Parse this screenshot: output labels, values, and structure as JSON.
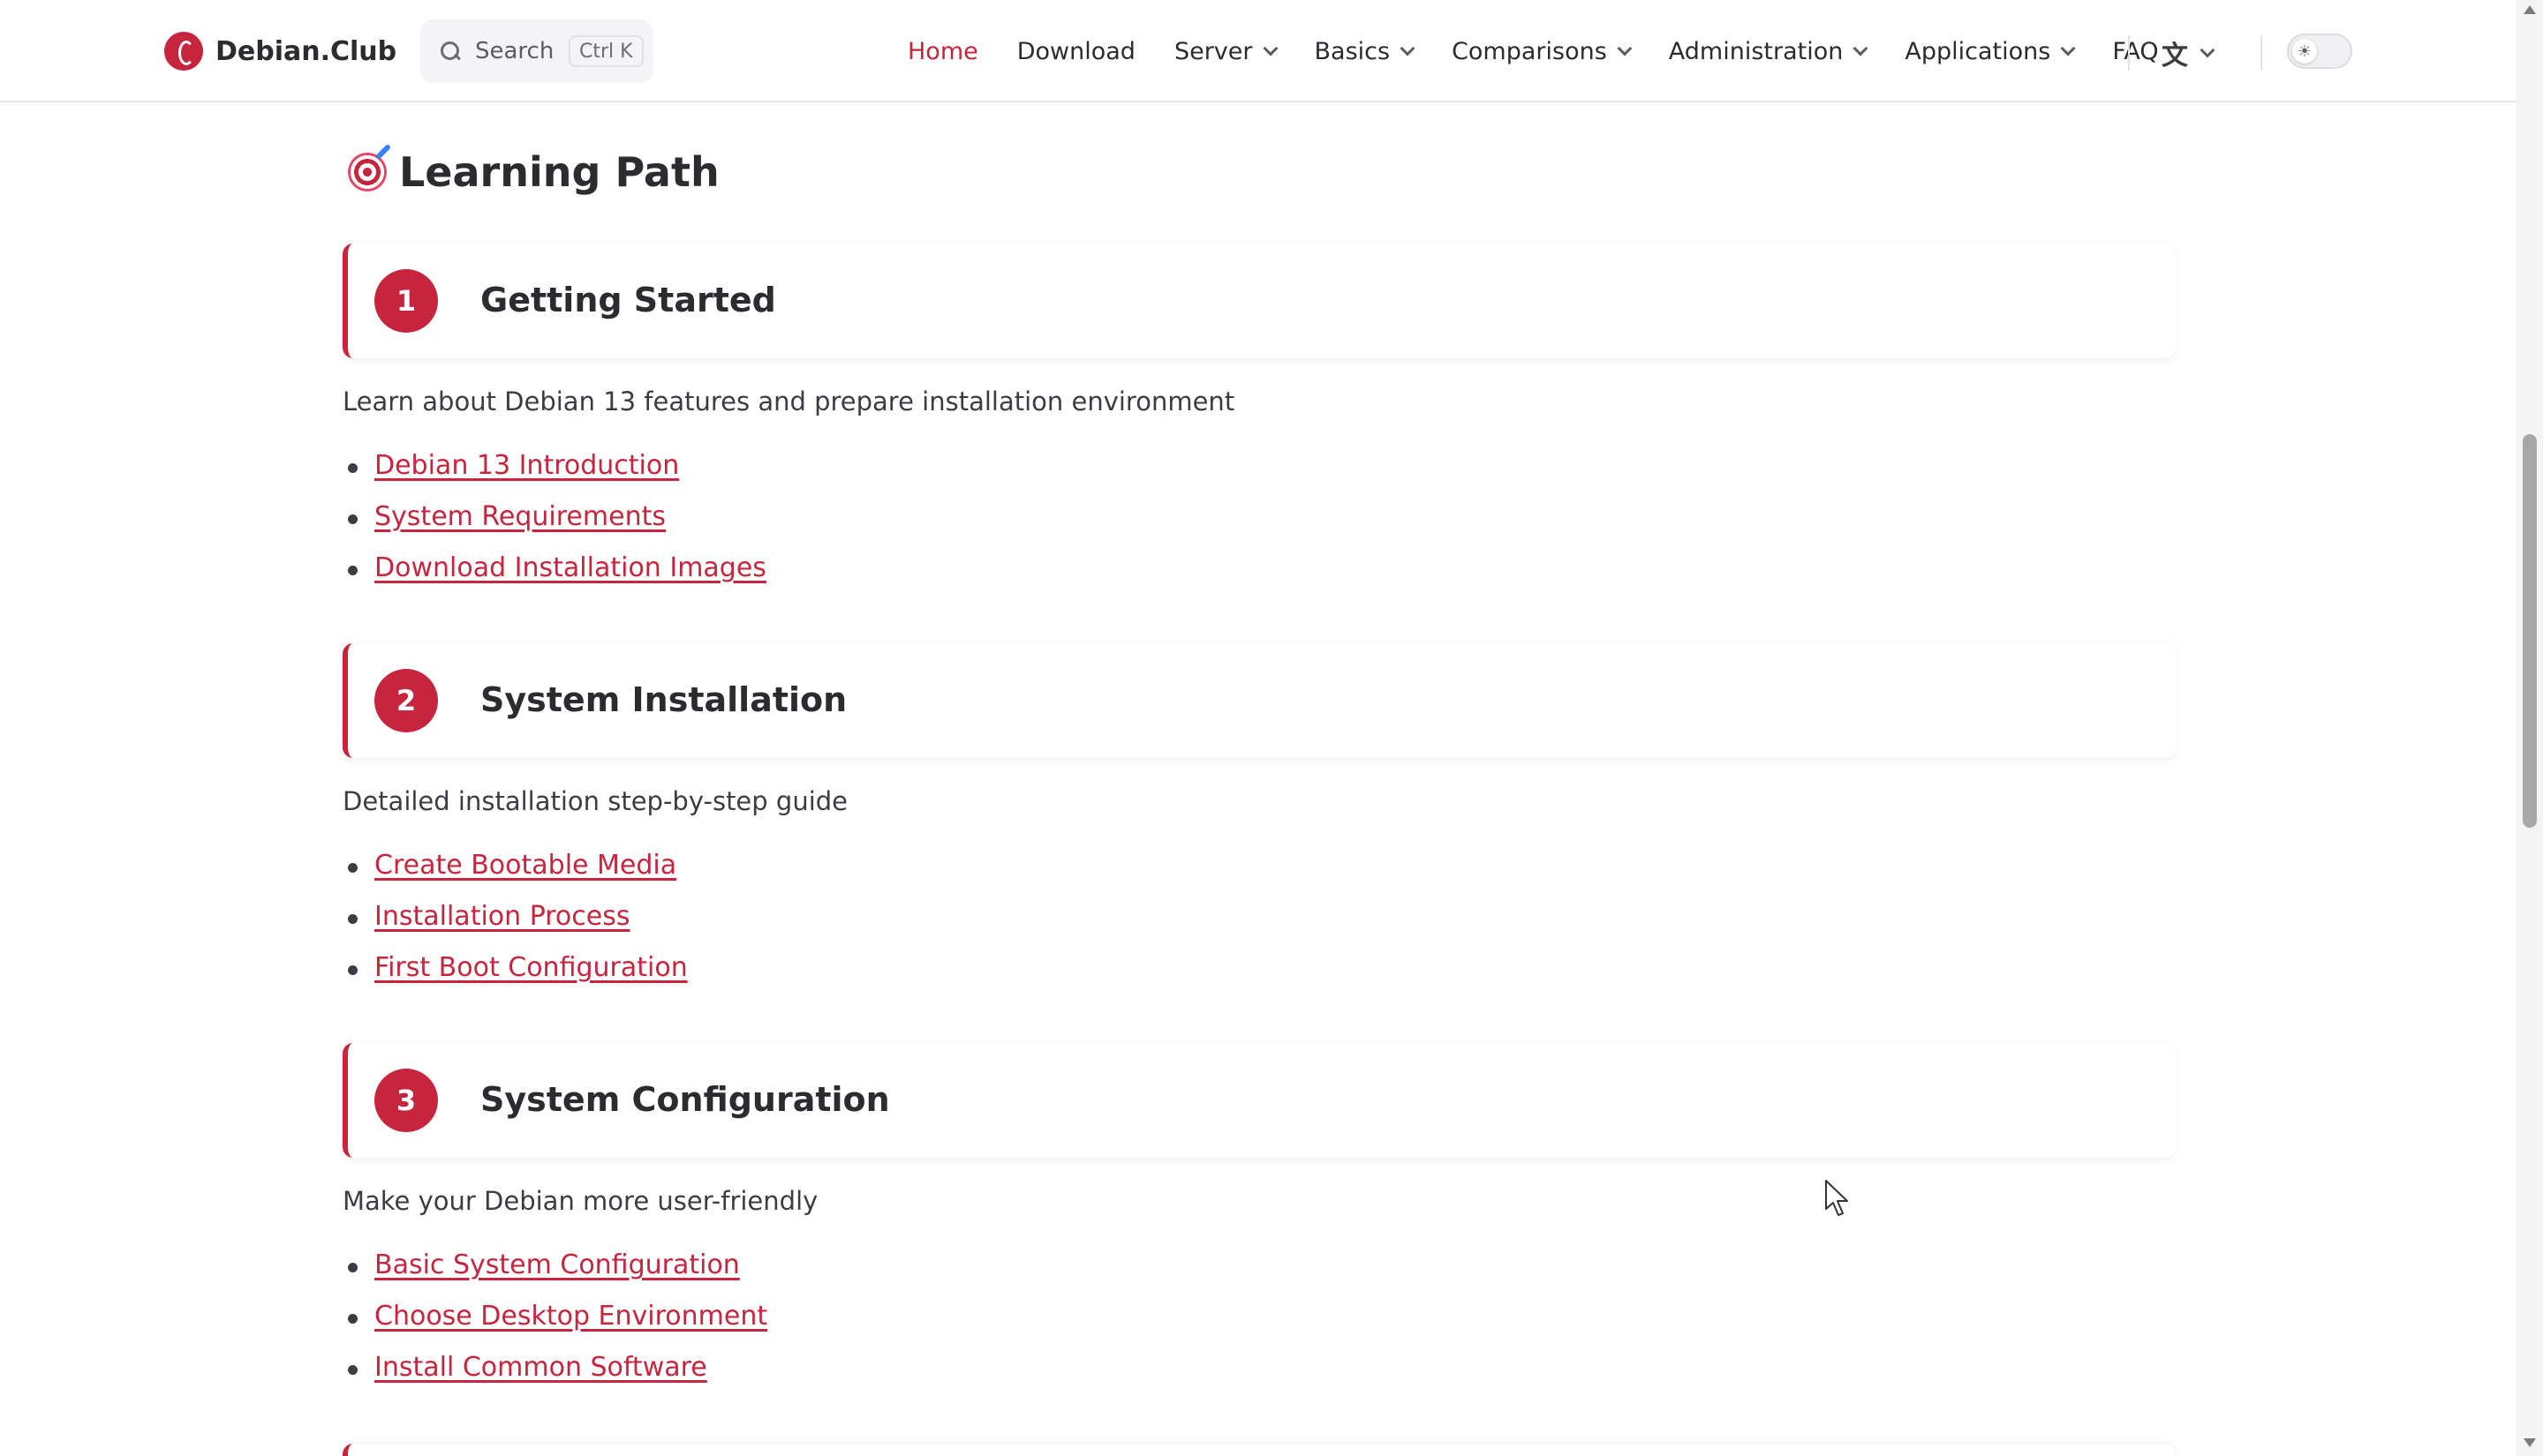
{
  "brand": {
    "name": "Debian.Club"
  },
  "search": {
    "label": "Search",
    "shortcut": "Ctrl K"
  },
  "nav": {
    "items": [
      {
        "label": "Home",
        "active": true,
        "dropdown": false
      },
      {
        "label": "Download",
        "dropdown": false
      },
      {
        "label": "Server",
        "dropdown": true
      },
      {
        "label": "Basics",
        "dropdown": true
      },
      {
        "label": "Comparisons",
        "dropdown": true
      },
      {
        "label": "Administration",
        "dropdown": true
      },
      {
        "label": "Applications",
        "dropdown": true
      },
      {
        "label": "FAQ",
        "dropdown": false
      }
    ],
    "language_icon": "translate-icon",
    "theme_icon": "sun-icon"
  },
  "colors": {
    "accent": "#c7253e",
    "text": "#3c3c43",
    "heading": "#2c2c30"
  },
  "main": {
    "section_title": "Learning Path",
    "section_icon": "target-icon",
    "steps": [
      {
        "number": "1",
        "title": "Getting Started",
        "description": "Learn about Debian 13 features and prepare installation environment",
        "links": [
          "Debian 13 Introduction",
          "System Requirements",
          "Download Installation Images"
        ]
      },
      {
        "number": "2",
        "title": "System Installation",
        "description": "Detailed installation step-by-step guide",
        "links": [
          "Create Bootable Media",
          "Installation Process",
          "First Boot Configuration"
        ]
      },
      {
        "number": "3",
        "title": "System Configuration",
        "description": "Make your Debian more user-friendly",
        "links": [
          "Basic System Configuration",
          "Choose Desktop Environment",
          "Install Common Software"
        ]
      }
    ]
  }
}
